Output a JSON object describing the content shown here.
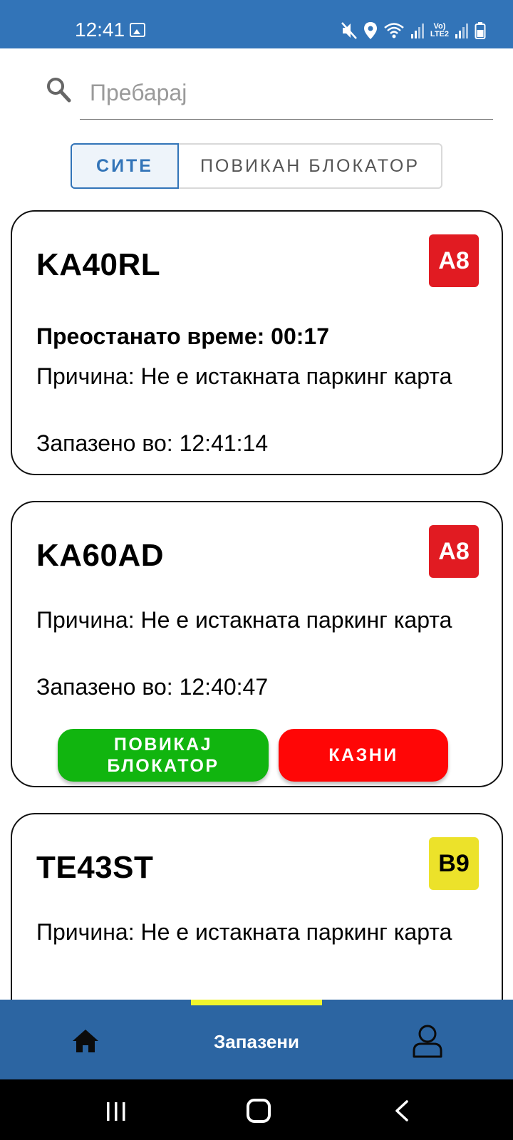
{
  "status_bar": {
    "time": "12:41",
    "lte_label": "LTE2",
    "volte_label": "Vo)"
  },
  "search": {
    "placeholder": "Пребарај"
  },
  "filter": {
    "all_label": "СИТЕ",
    "called_label": "ПОВИКАН БЛОКАТОР",
    "selected": "СИТЕ"
  },
  "cards": [
    {
      "plate": "KA40RL",
      "zone": "A8",
      "zone_color": "#e11b22",
      "remaining": "Преостанато време: 00:17",
      "reason": "Причина: Не е истакната паркинг карта",
      "saved_at": "Запазено во: 12:41:14"
    },
    {
      "plate": "KA60AD",
      "zone": "A8",
      "zone_color": "#e11b22",
      "reason": "Причина: Не е истакната паркинг карта",
      "saved_at": "Запазено во: 12:40:47",
      "call_button": "ПОВИКАЈ БЛОКАТОР",
      "fine_button": "КАЗНИ"
    },
    {
      "plate": "TE43ST",
      "zone": "B9",
      "zone_color": "#ece22a",
      "reason": "Причина: Не е истакната паркинг карта"
    }
  ],
  "bottom_nav": {
    "items": [
      {
        "icon": "home-icon"
      },
      {
        "label": "Запазени",
        "active": true
      },
      {
        "icon": "user-icon"
      }
    ],
    "indicator_color": "#f1f52d"
  },
  "colors": {
    "primary": "#3274b8",
    "nav": "#2c65a2",
    "green": "#11b50f",
    "red": "#ff0606"
  }
}
